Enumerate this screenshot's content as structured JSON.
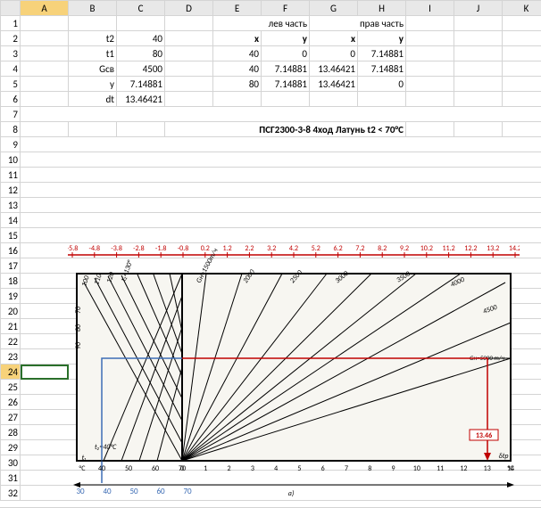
{
  "columns": [
    "",
    "A",
    "B",
    "C",
    "D",
    "E",
    "F",
    "G",
    "H",
    "I",
    "J",
    "K"
  ],
  "rows": [
    "1",
    "2",
    "3",
    "4",
    "5",
    "6",
    "7",
    "8",
    "9",
    "10",
    "11",
    "12",
    "13",
    "14",
    "15",
    "16",
    "17",
    "18",
    "19",
    "20",
    "21",
    "22",
    "23",
    "24",
    "25",
    "26",
    "27",
    "28",
    "29",
    "30",
    "31",
    "32"
  ],
  "active_cell": "A24",
  "labels": {
    "t2": "t2",
    "t1": "t1",
    "Gsv": "Gсв",
    "y": "y",
    "dt": "dt"
  },
  "inputs": {
    "t2": "40",
    "t1": "80",
    "Gsv": "4500",
    "y": "7.14881",
    "dt": "13.46421"
  },
  "lev_header": "лев часть",
  "prav_header": "прав часть",
  "table_hdr": {
    "x": "x",
    "y": "y"
  },
  "lev": [
    {
      "x": "40",
      "y": "0"
    },
    {
      "x": "40",
      "y": "7.14881"
    },
    {
      "x": "80",
      "y": "7.14881"
    }
  ],
  "prav": [
    {
      "x": "0",
      "y": "7.14881"
    },
    {
      "x": "13.46421",
      "y": "7.14881"
    },
    {
      "x": "13.46421",
      "y": "0"
    }
  ],
  "title": "ПСГ2300-3-8 4ход Латунь t2 < 70°C",
  "top_ticks": [
    "-5.8",
    "-4.8",
    "-3.8",
    "-2.8",
    "-1.8",
    "-0.8",
    "0.2",
    "1.2",
    "2.2",
    "3.2",
    "4.2",
    "5.2",
    "6.2",
    "7.2",
    "8.2",
    "9.2",
    "10.2",
    "11.2",
    "12.2",
    "13.2",
    "14.2"
  ],
  "bottom_ticks": [
    "30",
    "40",
    "50",
    "60",
    "70"
  ],
  "callout": "13.46",
  "chart_data": {
    "type": "combo_nomogram",
    "title": "ПСГ2300-3-8 4ход Латунь t2 < 70°C",
    "left_axis": {
      "label": "°C",
      "ticks": [
        70,
        80,
        90,
        100,
        110,
        120
      ]
    },
    "bottom_left_axis": {
      "label": "t1",
      "ticks": [
        40,
        50,
        60,
        70
      ],
      "unit": "°C"
    },
    "bottom_right_axis": {
      "label": "δtр",
      "ticks": [
        0,
        1,
        2,
        3,
        4,
        5,
        6,
        7,
        8,
        9,
        10,
        11,
        12,
        13,
        14
      ],
      "unit": "°C"
    },
    "upper_scale": {
      "ticks": [
        -5.8,
        -4.8,
        -3.8,
        -2.8,
        -1.8,
        -0.8,
        0.2,
        1.2,
        2.2,
        3.2,
        4.2,
        5.2,
        6.2,
        7.2,
        8.2,
        9.2,
        10.2,
        11.2,
        12.2,
        13.2,
        14.2
      ]
    },
    "left_family": {
      "label": "t2",
      "ticks": [
        100,
        110,
        120,
        130
      ],
      "unit": "°C"
    },
    "right_family": {
      "label": "Gн",
      "values": [
        1500,
        2000,
        2500,
        3000,
        3500,
        4000,
        4500,
        5000
      ],
      "unit": "т/ч"
    },
    "blue_path": {
      "series": "лев часть",
      "points": [
        [
          40,
          0
        ],
        [
          40,
          7.14881
        ],
        [
          80,
          7.14881
        ]
      ]
    },
    "red_path": {
      "series": "прав часть",
      "points": [
        [
          0,
          7.14881
        ],
        [
          13.46421,
          7.14881
        ],
        [
          13.46421,
          0
        ]
      ],
      "end_label": "13.46"
    },
    "note": "t2=40°C",
    "sublabel": "a)"
  }
}
